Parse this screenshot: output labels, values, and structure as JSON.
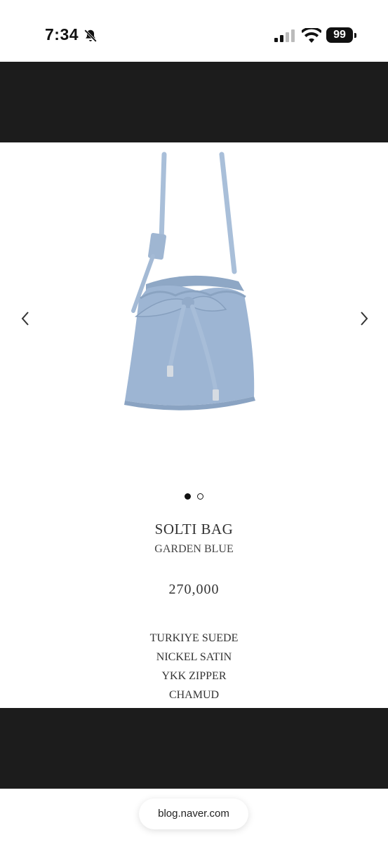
{
  "status_bar": {
    "time": "7:34",
    "battery": "99",
    "icons": [
      "bell-slash-icon",
      "signal-icon",
      "wifi-icon",
      "battery-icon"
    ]
  },
  "carousel": {
    "prev_icon": "chevron-left-icon",
    "next_icon": "chevron-right-icon",
    "active_slide": 1,
    "slide_count": 2,
    "bag_color": "#9db5d3"
  },
  "product": {
    "name": "SOLTI BAG",
    "color": "GARDEN BLUE",
    "price": "270,000",
    "specs": [
      "TURKIYE SUEDE",
      "NICKEL SATIN",
      "YKK ZIPPER",
      "CHAMUD"
    ]
  },
  "browser": {
    "url": "blog.naver.com"
  },
  "colors": {
    "band": "#1c1c1c",
    "background": "#ffffff"
  }
}
